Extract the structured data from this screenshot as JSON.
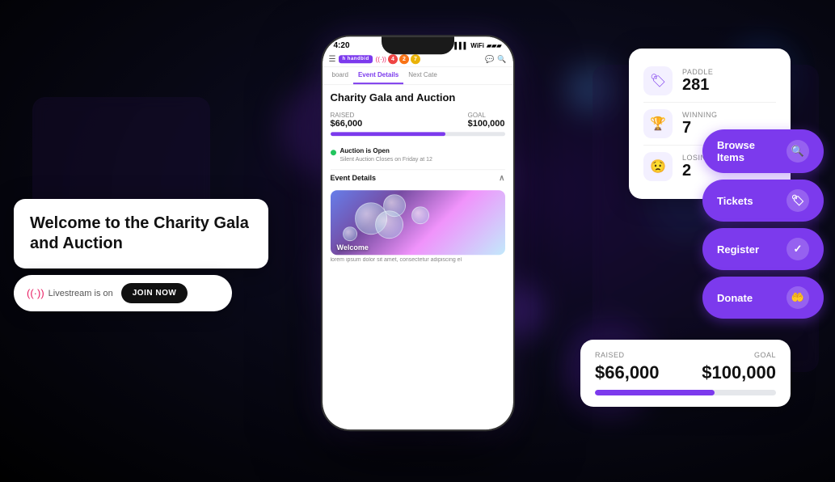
{
  "app": {
    "title": "Handbid Charity Gala"
  },
  "background": {
    "color": "#000"
  },
  "phone": {
    "status_time": "4:20",
    "app_name": "h handbid",
    "tabs": [
      {
        "label": "board",
        "active": false
      },
      {
        "label": "Event Details",
        "active": true
      },
      {
        "label": "Next Cate",
        "active": false
      }
    ],
    "event_title": "Charity Gala and Auction",
    "raised_label": "RAISED",
    "raised_amount": "$66,000",
    "goal_label": "GOAL",
    "goal_amount": "$100,000",
    "progress_percent": 66,
    "auction_status": "Auction is Open",
    "auction_sub": "Silent Auction Closes on Friday at 12",
    "section_title": "Event Details",
    "welcome_label": "Welcome",
    "lorem_text": "lorem ipsum dolor sit amet, consectetur adipiscing el"
  },
  "welcome_card": {
    "title": "Welcome to the Charity Gala and Auction"
  },
  "livestream": {
    "text": "Livestream is on",
    "button_label": "JOIN NOW"
  },
  "stats_card": {
    "paddle_label": "PADDLE",
    "paddle_value": "281",
    "winning_label": "WINNING",
    "winning_value": "7",
    "losing_label": "LOSING",
    "losing_value": "2"
  },
  "action_buttons": [
    {
      "label": "Browse Items",
      "icon": "🔍"
    },
    {
      "label": "Tickets",
      "icon": "🏷"
    },
    {
      "label": "Register",
      "icon": "✓"
    },
    {
      "label": "Donate",
      "icon": "🤲"
    }
  ],
  "raised_card": {
    "raised_label": "RAISED",
    "goal_label": "GOAL",
    "raised_amount": "$66,000",
    "goal_amount": "$100,000",
    "progress_percent": 66
  }
}
